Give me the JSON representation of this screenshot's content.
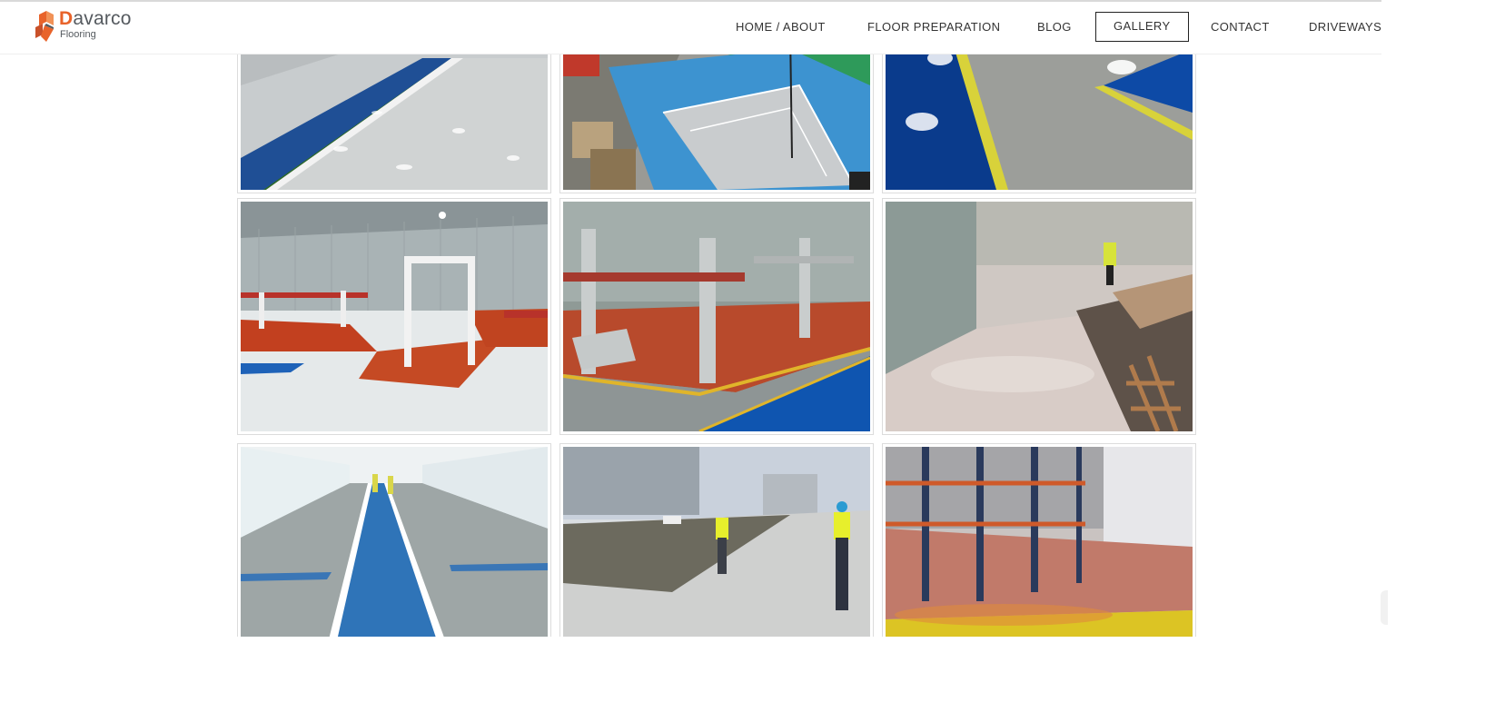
{
  "brand": {
    "name_initial": "D",
    "name_rest": "avarco",
    "tagline": "Flooring",
    "logo_icon": "davarco-cube-logo",
    "accent_orange": "#e8632a",
    "accent_dark": "#555a5f"
  },
  "nav": {
    "items": [
      {
        "label": "HOME / ABOUT"
      },
      {
        "label": "FLOOR PREPARATION"
      },
      {
        "label": "BLOG"
      },
      {
        "label": "GALLERY",
        "active": true
      },
      {
        "label": "CONTACT"
      },
      {
        "label": "DRIVEWAYS"
      }
    ]
  },
  "gallery": {
    "images": [
      {
        "subject": "grey epoxy floor with blue and green lane"
      },
      {
        "subject": "warehouse floor with blue, green and grey zones"
      },
      {
        "subject": "glossy grey floor with blue area and yellow line"
      },
      {
        "subject": "garage with red lift bays on grey floor"
      },
      {
        "subject": "vehicle lift on red bay with blue walkway"
      },
      {
        "subject": "long glossy cream floor with worker"
      },
      {
        "subject": "covered car park deck with blue walkway"
      },
      {
        "subject": "rooftop deck coating with two workers"
      },
      {
        "subject": "warehouse racking with yellow floor"
      }
    ]
  }
}
